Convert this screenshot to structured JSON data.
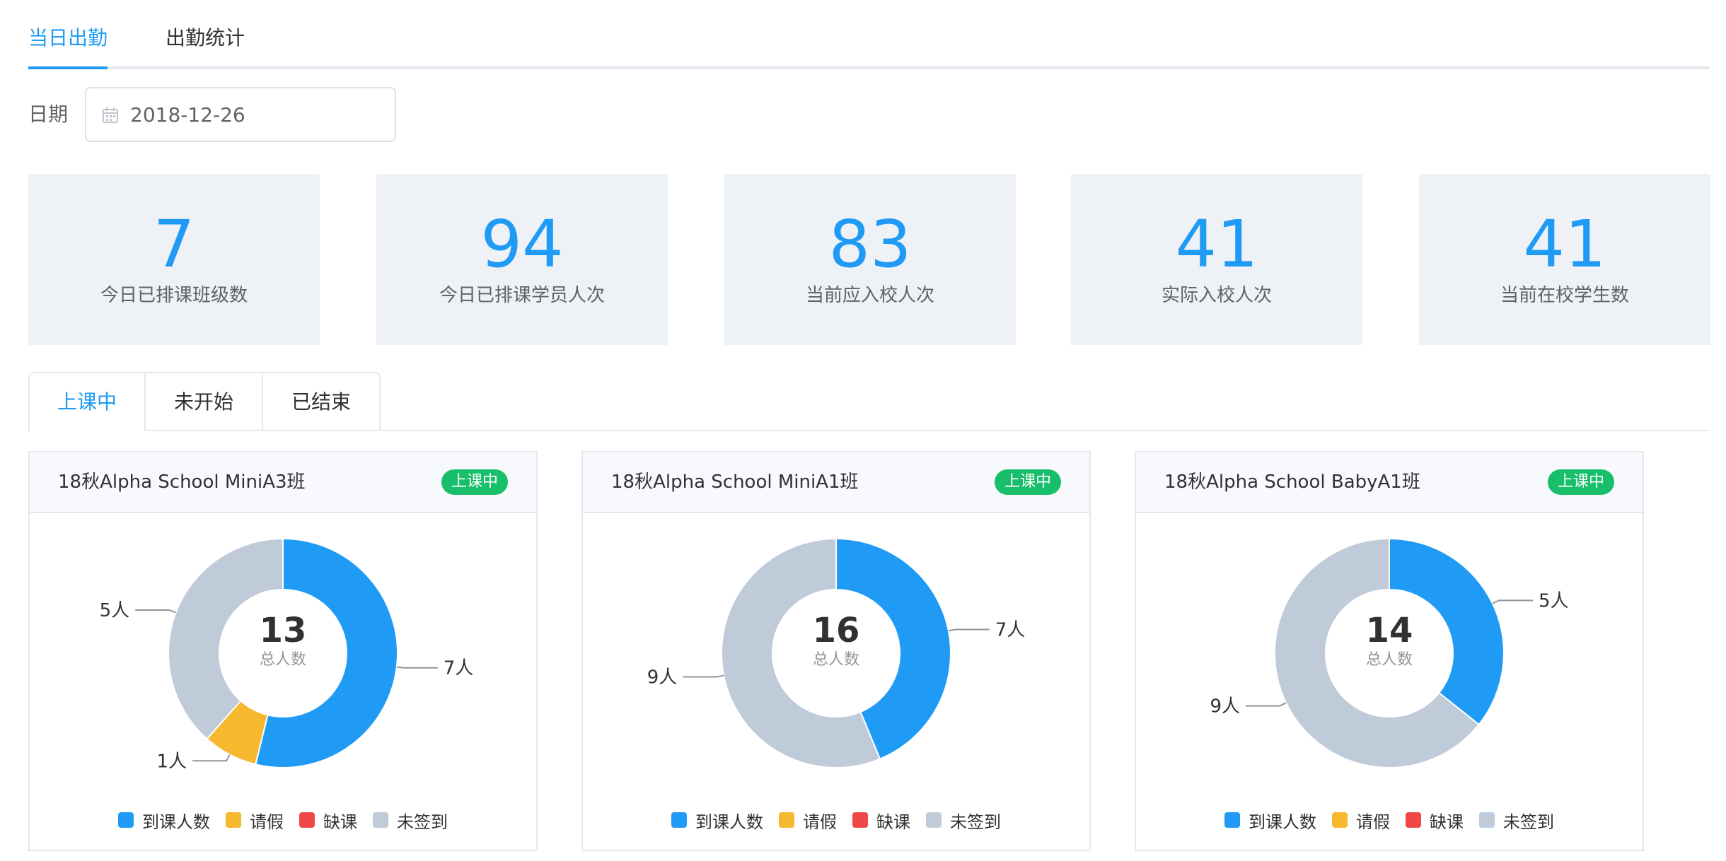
{
  "top_tabs": [
    "当日出勤",
    "出勤统计"
  ],
  "date": {
    "label": "日期",
    "value": "2018-12-26",
    "icon": "calendar-icon"
  },
  "stats": [
    {
      "value": "7",
      "label": "今日已排课班级数"
    },
    {
      "value": "94",
      "label": "今日已排课学员人次"
    },
    {
      "value": "83",
      "label": "当前应入校人次"
    },
    {
      "value": "41",
      "label": "实际入校人次"
    },
    {
      "value": "41",
      "label": "当前在校学生数"
    }
  ],
  "status_tabs": [
    "上课中",
    "未开始",
    "已结束"
  ],
  "legend": [
    {
      "label": "到课人数",
      "color": "#1f9bf5"
    },
    {
      "label": "请假",
      "color": "#f5b82e"
    },
    {
      "label": "缺课",
      "color": "#f04848"
    },
    {
      "label": "未签到",
      "color": "#c0cbd9"
    }
  ],
  "classes": [
    {
      "title": "18秋Alpha School MiniA3班",
      "badge": "上课中",
      "total": "13",
      "caption": "总人数",
      "slices": [
        {
          "category": "到课人数",
          "value": 7,
          "label": "7人"
        },
        {
          "category": "请假",
          "value": 1,
          "label": "1人"
        },
        {
          "category": "缺课",
          "value": 0,
          "label": ""
        },
        {
          "category": "未签到",
          "value": 5,
          "label": "5人"
        }
      ]
    },
    {
      "title": "18秋Alpha School MiniA1班",
      "badge": "上课中",
      "total": "16",
      "caption": "总人数",
      "slices": [
        {
          "category": "到课人数",
          "value": 7,
          "label": "7人"
        },
        {
          "category": "请假",
          "value": 0,
          "label": ""
        },
        {
          "category": "缺课",
          "value": 0,
          "label": ""
        },
        {
          "category": "未签到",
          "value": 9,
          "label": "9人"
        }
      ]
    },
    {
      "title": "18秋Alpha School BabyA1班",
      "badge": "上课中",
      "total": "14",
      "caption": "总人数",
      "slices": [
        {
          "category": "到课人数",
          "value": 5,
          "label": "5人"
        },
        {
          "category": "请假",
          "value": 0,
          "label": ""
        },
        {
          "category": "缺课",
          "value": 0,
          "label": ""
        },
        {
          "category": "未签到",
          "value": 9,
          "label": "9人"
        }
      ]
    }
  ],
  "chart_data": [
    {
      "type": "pie",
      "categories": [
        "到课人数",
        "请假",
        "缺课",
        "未签到"
      ],
      "values": [
        7,
        1,
        0,
        5
      ],
      "title": "18秋Alpha School MiniA3班"
    },
    {
      "type": "pie",
      "categories": [
        "到课人数",
        "请假",
        "缺课",
        "未签到"
      ],
      "values": [
        7,
        0,
        0,
        9
      ],
      "title": "18秋Alpha School MiniA1班"
    },
    {
      "type": "pie",
      "categories": [
        "到课人数",
        "请假",
        "缺课",
        "未签到"
      ],
      "values": [
        5,
        0,
        0,
        9
      ],
      "title": "18秋Alpha School BabyA1班"
    }
  ]
}
